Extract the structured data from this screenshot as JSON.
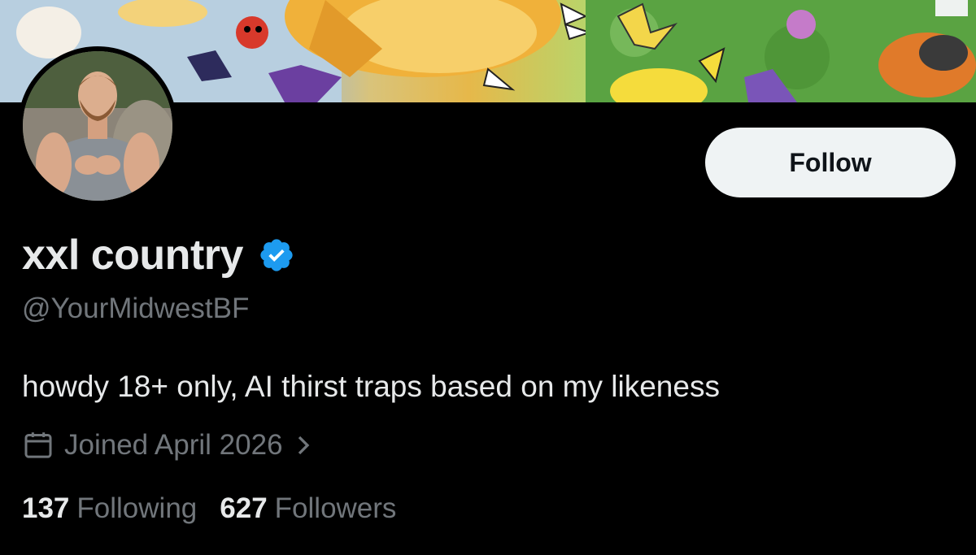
{
  "profile": {
    "display_name": "xxl country",
    "handle": "@YourMidwestBF",
    "bio": "howdy 18+ only, AI thirst traps based on my likeness",
    "joined": "Joined April 2026",
    "verified": true
  },
  "actions": {
    "follow_label": "Follow"
  },
  "stats": {
    "following_count": "137",
    "following_label": "Following",
    "followers_count": "627",
    "followers_label": "Followers"
  },
  "icons": {
    "verified": "verified-badge-icon",
    "calendar": "calendar-icon",
    "chevron": "chevron-right-icon"
  },
  "colors": {
    "background": "#000000",
    "text_primary": "#e7e9ea",
    "text_secondary": "#71767b",
    "verified_blue": "#1d9bf0",
    "button_bg": "#eff3f4",
    "button_text": "#0f1419"
  }
}
